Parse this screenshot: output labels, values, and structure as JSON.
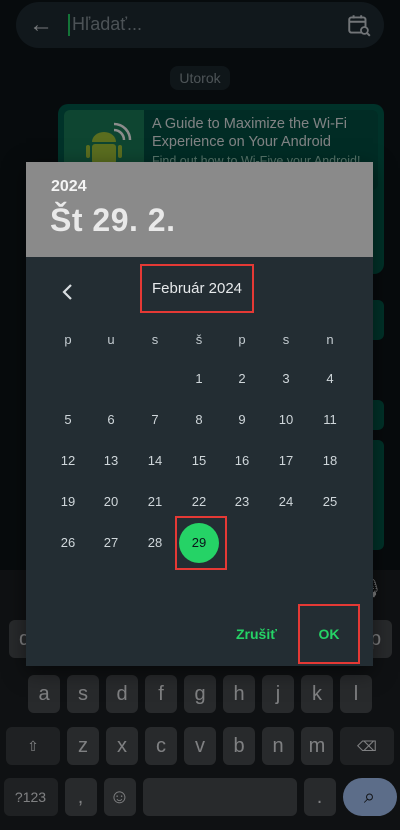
{
  "search": {
    "placeholder": "Hľadať..."
  },
  "chat": {
    "day_chip": "Utorok",
    "card_title": "A Guide to Maximize the Wi-Fi Experience on Your Android",
    "card_desc": "Find out how to Wi-Five your Android!"
  },
  "keyboard": {
    "row1": [
      "q",
      "w",
      "e",
      "r",
      "t",
      "z",
      "u",
      "i",
      "o",
      "p"
    ],
    "row2": [
      "a",
      "s",
      "d",
      "f",
      "g",
      "h",
      "j",
      "k",
      "l"
    ],
    "row3": [
      "z",
      "x",
      "c",
      "v",
      "b",
      "n",
      "m"
    ],
    "sym_label": "?123",
    "comma": ",",
    "period": "."
  },
  "dialog": {
    "year": "2024",
    "selected_date": "Št 29. 2.",
    "month_label": "Február 2024",
    "weekdays": [
      "p",
      "u",
      "s",
      "š",
      "p",
      "s",
      "n"
    ],
    "days": [
      [
        "",
        "",
        "",
        "1",
        "2",
        "3",
        "4"
      ],
      [
        "5",
        "6",
        "7",
        "8",
        "9",
        "10",
        "11"
      ],
      [
        "12",
        "13",
        "14",
        "15",
        "16",
        "17",
        "18"
      ],
      [
        "19",
        "20",
        "21",
        "22",
        "23",
        "24",
        "25"
      ],
      [
        "26",
        "27",
        "28",
        "29",
        "",
        "",
        ""
      ]
    ],
    "selected_day": "29",
    "cancel_label": "Zrušiť",
    "ok_label": "OK"
  },
  "colors": {
    "accent": "#25d366",
    "dialog_bg": "#232d33",
    "header_bg": "#8a8a8a",
    "highlight_box": "#e53935"
  }
}
